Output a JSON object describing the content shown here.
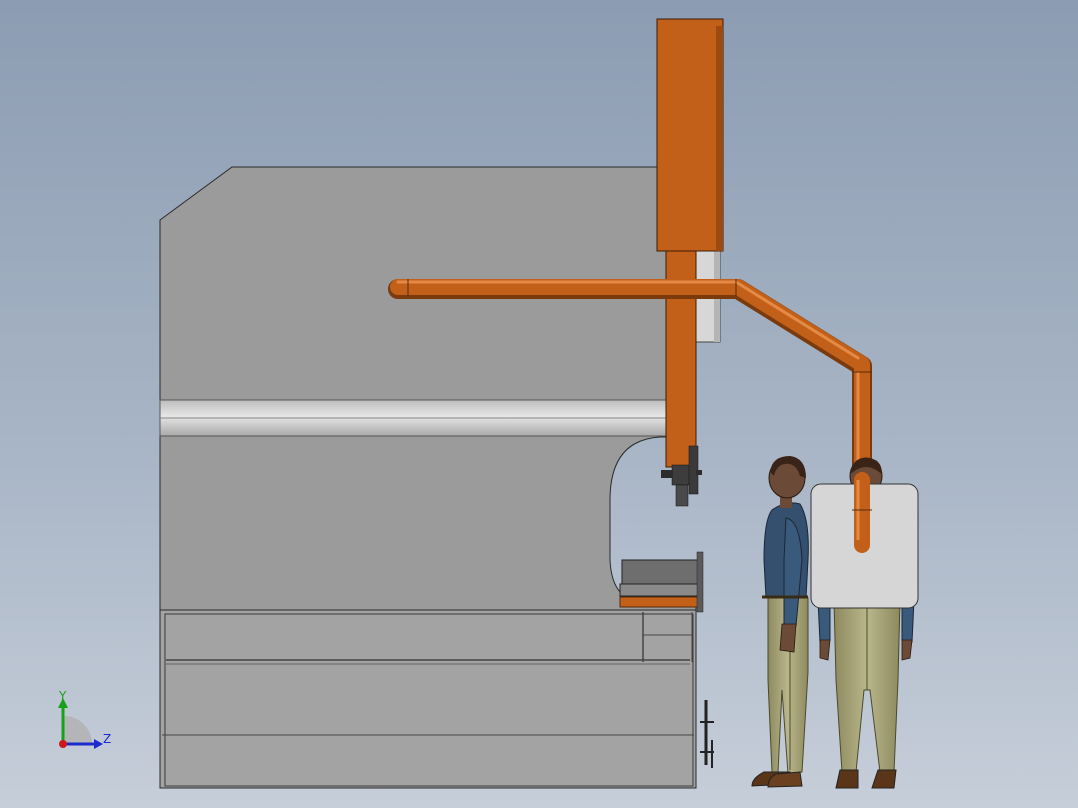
{
  "viewport": {
    "background_top": "#8c9cb2",
    "background_bottom": "#c6ced9"
  },
  "colors": {
    "machine_body": "#9b9b9b",
    "machine_rail": "#cfcfcf",
    "accent_orange": "#c2601a",
    "tooling_dark": "#3d3d3d",
    "figure_jacket": "#34506e",
    "figure_pants": "#a8a67a",
    "figure_skin": "#6b4a37",
    "guard_panel": "#d6d6d6"
  },
  "triad": {
    "x_label": "",
    "y_label": "Y",
    "z_label": "Z",
    "y_color": "#18a018",
    "z_color": "#1a2ad0",
    "origin_color": "#d01818"
  }
}
